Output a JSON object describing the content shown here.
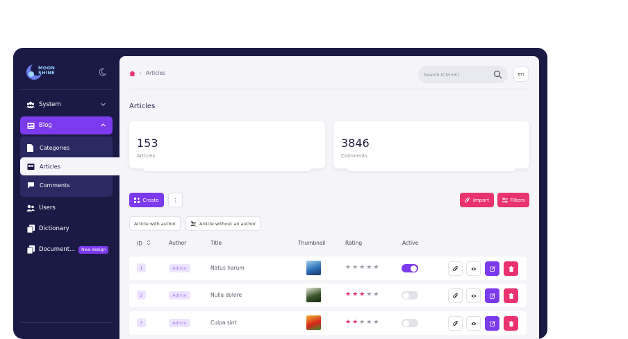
{
  "app": {
    "logo_line1": "MOON",
    "logo_line2": "SHINE"
  },
  "sidebar": {
    "items": [
      {
        "label": "System"
      },
      {
        "label": "Blog"
      },
      {
        "label": "Categories"
      },
      {
        "label": "Articles"
      },
      {
        "label": "Comments"
      },
      {
        "label": "Users"
      },
      {
        "label": "Dictionary"
      },
      {
        "label": "Document...",
        "badge": "New design"
      }
    ]
  },
  "header": {
    "breadcrumb_current": "Articles",
    "search_placeholder": "Search (Ctrl+K)",
    "lang": "en"
  },
  "page": {
    "title": "Articles"
  },
  "stats": [
    {
      "value": "153",
      "label": "Articles"
    },
    {
      "value": "3846",
      "label": "Comments"
    }
  ],
  "toolbar": {
    "create": "Create",
    "more": "⋮",
    "import": "Import",
    "filters": "Filters"
  },
  "filter_chips": [
    "Article with author",
    "Article without an author"
  ],
  "table": {
    "headers": [
      "ID",
      "Author",
      "Title",
      "Thumbnail",
      "Rating",
      "Active"
    ],
    "rows": [
      {
        "id": "1",
        "author": "Admin",
        "title": "Natus harum",
        "rating": 0,
        "active": true
      },
      {
        "id": "2",
        "author": "Admin",
        "title": "Nulla dolore",
        "rating": 3,
        "active": false
      },
      {
        "id": "3",
        "author": "Admin",
        "title": "Culpa sint",
        "rating": 2,
        "active": false
      }
    ]
  },
  "colors": {
    "sidebar_bg": "#1b1a45",
    "primary": "#7c3aed",
    "danger": "#e8336f",
    "content_bg": "#f4f4f9"
  }
}
